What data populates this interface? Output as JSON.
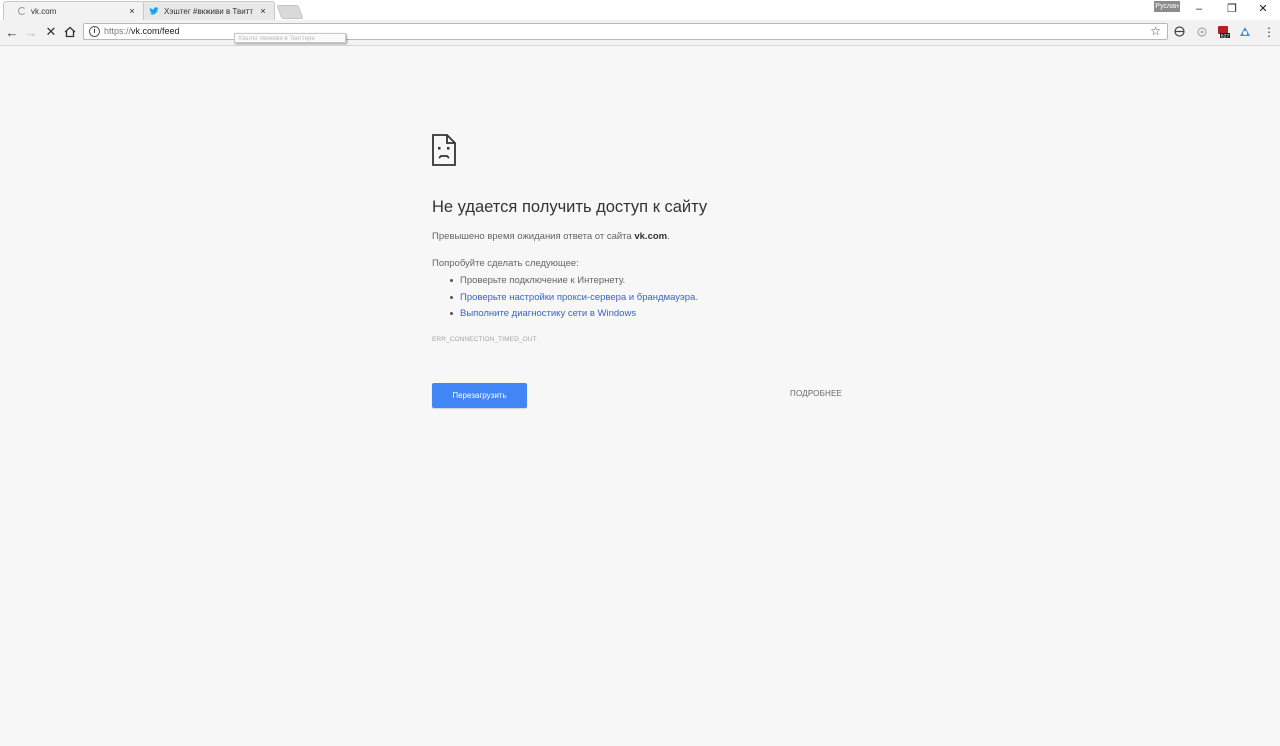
{
  "browser": {
    "tabs": [
      {
        "title": "vk.com",
        "state": "loading",
        "close": "×"
      },
      {
        "title": "Хэштег #вкживи в Твитт",
        "icon": "twitter-bird-icon",
        "close": "×"
      }
    ],
    "profile_name": "Руслан",
    "window_controls": {
      "minimize": "–",
      "restore": "❐",
      "close": "✕"
    },
    "tooltip": "Хэштег #вкживи в Твиттере"
  },
  "toolbar": {
    "back": "←",
    "forward": "→",
    "stop": "✕",
    "home": "⌂",
    "url_scheme": "https://",
    "url_rest": "vk.com/feed",
    "info_icon": "i",
    "star": "☆",
    "menu": "⋮",
    "extensions": [
      "vpn-icon",
      "ghost-icon",
      "adblock-icon",
      "pushbullet-icon"
    ],
    "adblock_badge": "627"
  },
  "error_page": {
    "heading": "Не удается получить доступ к сайту",
    "summary_prefix": "Превышено время ожидания ответа от сайта ",
    "summary_host": "vk.com",
    "summary_suffix": ".",
    "suggestions_title": "Попробуйте сделать следующее:",
    "suggestions": [
      "Проверьте подключение к Интернету.",
      "Проверьте настройки прокси-сервера и брандмауэра.",
      "Выполните диагностику сети в Windows"
    ],
    "error_code": "ERR_CONNECTION_TIMED_OUT",
    "reload_button": "Перезагрузить",
    "details_button": "ПОДРОБНЕЕ"
  },
  "colors": {
    "page_background": "#f7f7f7",
    "reload_button": "#4285f4",
    "link": "#3b62c8",
    "heading": "#333333"
  }
}
